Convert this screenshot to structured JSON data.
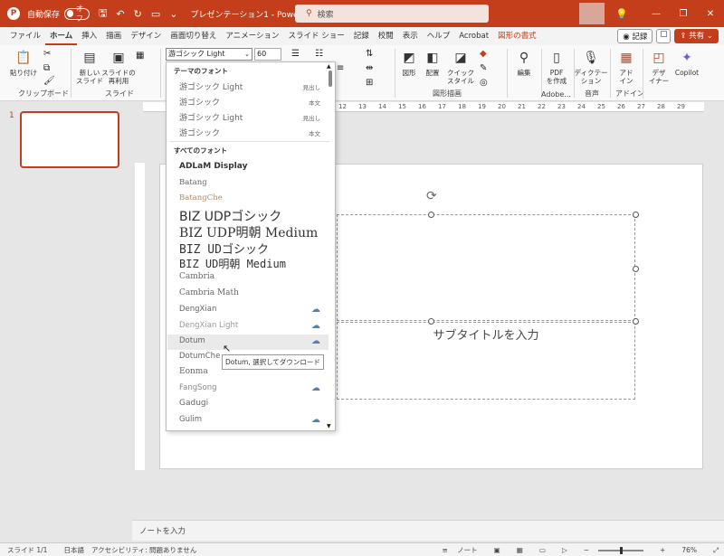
{
  "titlebar": {
    "autosave_label": "自動保存",
    "toggle_state": "オフ",
    "doc_title": "プレゼンテーション1 - Power...",
    "search_placeholder": "検索"
  },
  "menu": {
    "tabs": [
      "ファイル",
      "ホーム",
      "挿入",
      "描画",
      "デザイン",
      "画面切り替え",
      "アニメーション",
      "スライド ショー",
      "記録",
      "校閲",
      "表示",
      "ヘルプ",
      "Acrobat",
      "図形の書式"
    ],
    "active_tab": "ホーム",
    "record_label": "記録",
    "share_label": "共有"
  },
  "ribbon": {
    "paste_label": "貼り付け",
    "clipboard_group": "クリップボード",
    "new_slide_label": "新しい\nスライド",
    "reuse_label": "スライドの\n再利用",
    "slides_group": "スライド",
    "font_name": "游ゴシック Light",
    "font_size": "60",
    "shape_label": "図形",
    "arrange_label": "配置",
    "quick_style_label": "クイック\nスタイル",
    "drawing_group": "図形描画",
    "edit_label": "編集",
    "pdf_label": "PDF\nを作成",
    "adobe_group": "Adobe...",
    "dictation_label": "ディクテー\nション",
    "voice_group": "音声",
    "addin_label": "アド\nイン",
    "addin_group": "アドイン",
    "designer_label": "デザ\nイナー",
    "copilot_label": "Copilot"
  },
  "thumbnails": {
    "slide_number": "1"
  },
  "ruler": {
    "h_ticks": [
      "12",
      "13",
      "14",
      "15",
      "16",
      "17",
      "18",
      "19",
      "20",
      "21",
      "22",
      "23",
      "24",
      "25",
      "26",
      "27",
      "28",
      "29"
    ]
  },
  "slide": {
    "subtitle_placeholder": "サブタイトルを入力"
  },
  "font_dropdown": {
    "theme_header": "テーマのフォント",
    "theme_fonts": [
      {
        "name": "游ゴシック Light",
        "tag": "見出し"
      },
      {
        "name": "游ゴシック",
        "tag": "本文"
      },
      {
        "name": "游ゴシック Light",
        "tag": "見出し"
      },
      {
        "name": "游ゴシック",
        "tag": "本文"
      }
    ],
    "all_header": "すべてのフォント",
    "all_fonts": [
      {
        "name": "ADLaM Display",
        "cloud": false
      },
      {
        "name": "Batang",
        "cloud": false
      },
      {
        "name": "BatangChe",
        "cloud": false
      },
      {
        "name": "BIZ UDPゴシック",
        "cloud": false
      },
      {
        "name": "BIZ UDP明朝 Medium",
        "cloud": false
      },
      {
        "name": "BIZ UDゴシック",
        "cloud": false
      },
      {
        "name": "BIZ UD明朝 Medium",
        "cloud": false
      },
      {
        "name": "Cambria",
        "cloud": false
      },
      {
        "name": "Cambria Math",
        "cloud": false
      },
      {
        "name": "DengXian",
        "cloud": true
      },
      {
        "name": "DengXian Light",
        "cloud": true
      },
      {
        "name": "Dotum",
        "cloud": true
      },
      {
        "name": "DotumChe",
        "cloud": true
      },
      {
        "name": "Eonma",
        "cloud": false
      },
      {
        "name": "FangSong",
        "cloud": true
      },
      {
        "name": "Gadugi",
        "cloud": false
      },
      {
        "name": "Gulim",
        "cloud": true
      }
    ],
    "tooltip": "Dotum, 選択してダウンロード"
  },
  "notes": {
    "placeholder": "ノートを入力"
  },
  "status": {
    "slide_info": "スライド 1/1",
    "language": "日本語",
    "accessibility": "アクセシビリティ: 問題ありません",
    "notes_label": "ノート",
    "zoom": "76%"
  }
}
